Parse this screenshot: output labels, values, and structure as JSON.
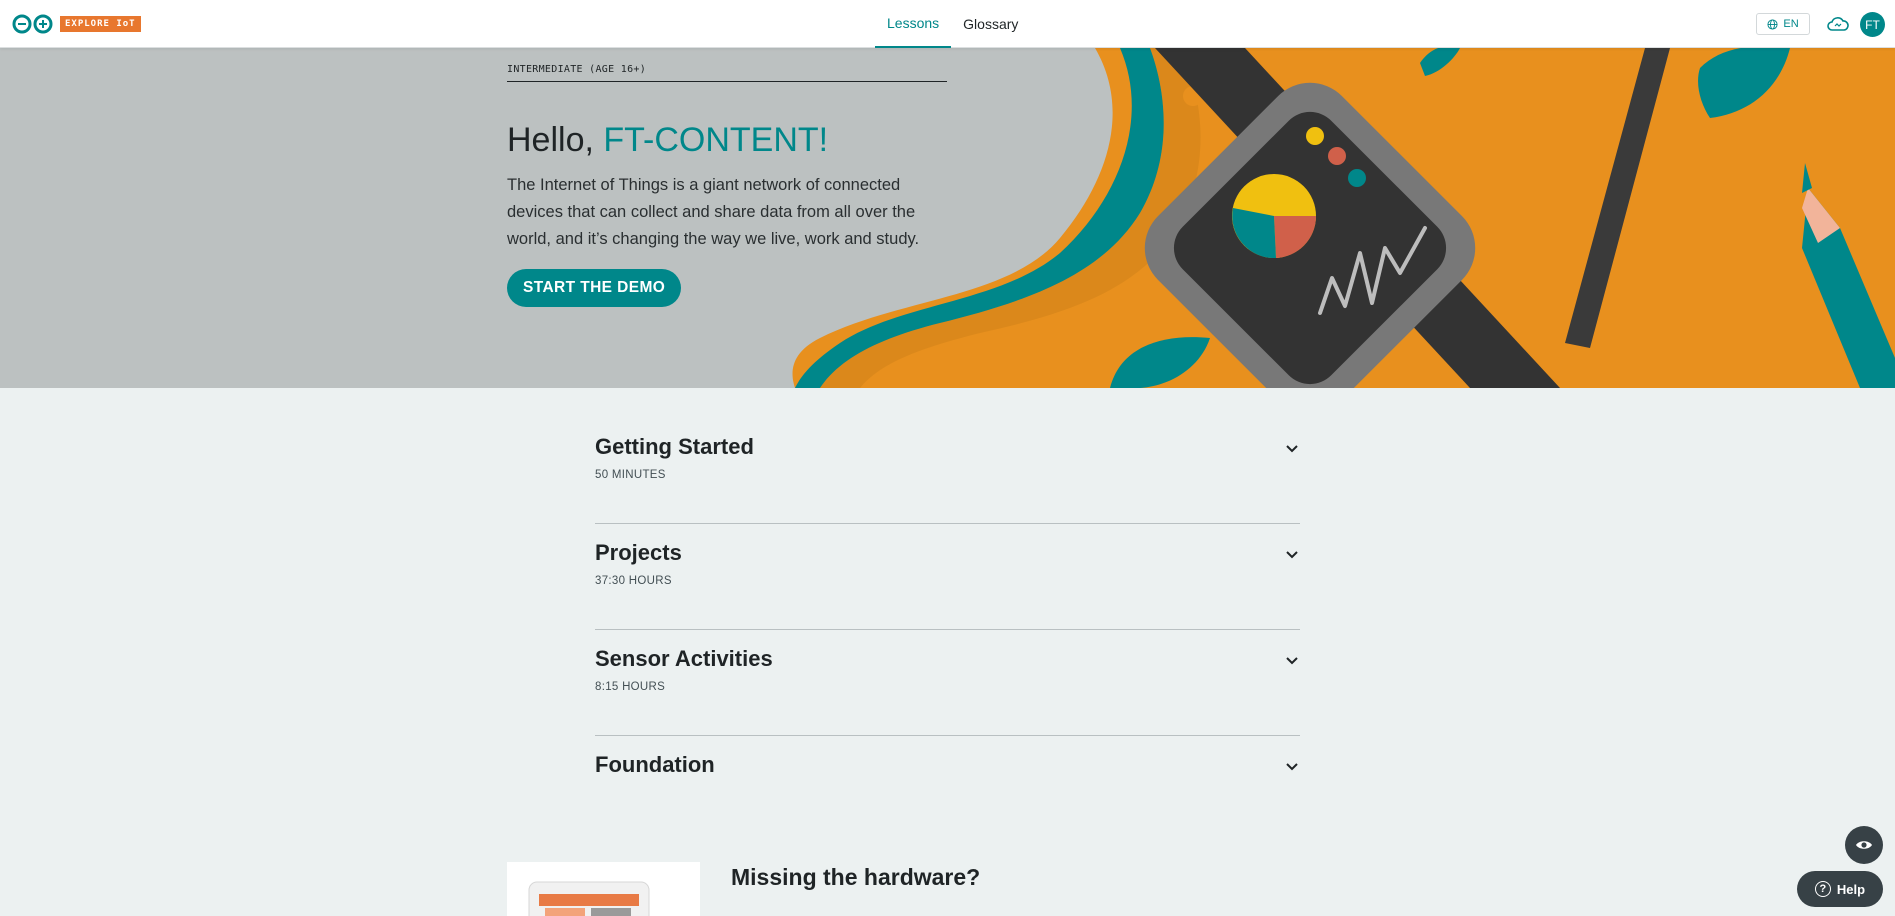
{
  "header": {
    "logo_badge": "EXPLORE IoT",
    "tabs": [
      {
        "label": "Lessons",
        "active": true
      },
      {
        "label": "Glossary",
        "active": false
      }
    ],
    "language": "EN",
    "avatar_initials": "FT"
  },
  "hero": {
    "level": "INTERMEDIATE (AGE 16+)",
    "greeting_prefix": "Hello, ",
    "user_name": "FT-CONTENT!",
    "intro": "The Internet of Things is a giant network of connected devices that can collect and share data from all over the world, and it’s changing the way we live, work and study.",
    "cta_label": "START THE DEMO"
  },
  "sections": [
    {
      "title": "Getting Started",
      "duration": "50 MINUTES"
    },
    {
      "title": "Projects",
      "duration": "37:30 HOURS"
    },
    {
      "title": "Sensor Activities",
      "duration": "8:15 HOURS"
    },
    {
      "title": "Foundation",
      "duration": ""
    }
  ],
  "hardware": {
    "title": "Missing the hardware?"
  },
  "floating": {
    "help_label": "Help"
  },
  "colors": {
    "accent": "#00878a",
    "hero_bg": "#bcc1c1",
    "orange": "#e8901e",
    "page_bg": "#ecf1f1",
    "dark": "#374146"
  }
}
